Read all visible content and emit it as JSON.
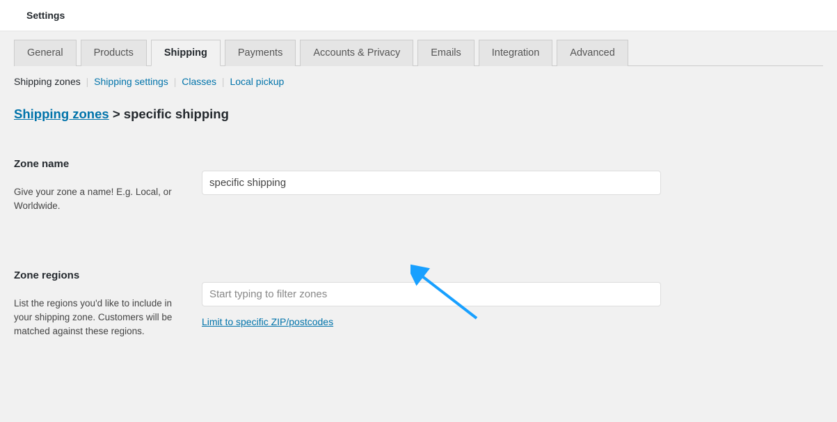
{
  "header": {
    "title": "Settings"
  },
  "tabs": [
    {
      "label": "General"
    },
    {
      "label": "Products"
    },
    {
      "label": "Shipping"
    },
    {
      "label": "Payments"
    },
    {
      "label": "Accounts & Privacy"
    },
    {
      "label": "Emails"
    },
    {
      "label": "Integration"
    },
    {
      "label": "Advanced"
    }
  ],
  "subtabs": {
    "zones": "Shipping zones",
    "settings": "Shipping settings",
    "classes": "Classes",
    "pickup": "Local pickup"
  },
  "breadcrumb": {
    "root": "Shipping zones",
    "sep": ">",
    "current": "specific shipping"
  },
  "zone_name": {
    "label": "Zone name",
    "desc": "Give your zone a name! E.g. Local, or Worldwide.",
    "value": "specific shipping"
  },
  "zone_regions": {
    "label": "Zone regions",
    "desc": "List the regions you'd like to include in your shipping zone. Customers will be matched against these regions.",
    "placeholder": "Start typing to filter zones",
    "limit_link": "Limit to specific ZIP/postcodes"
  }
}
